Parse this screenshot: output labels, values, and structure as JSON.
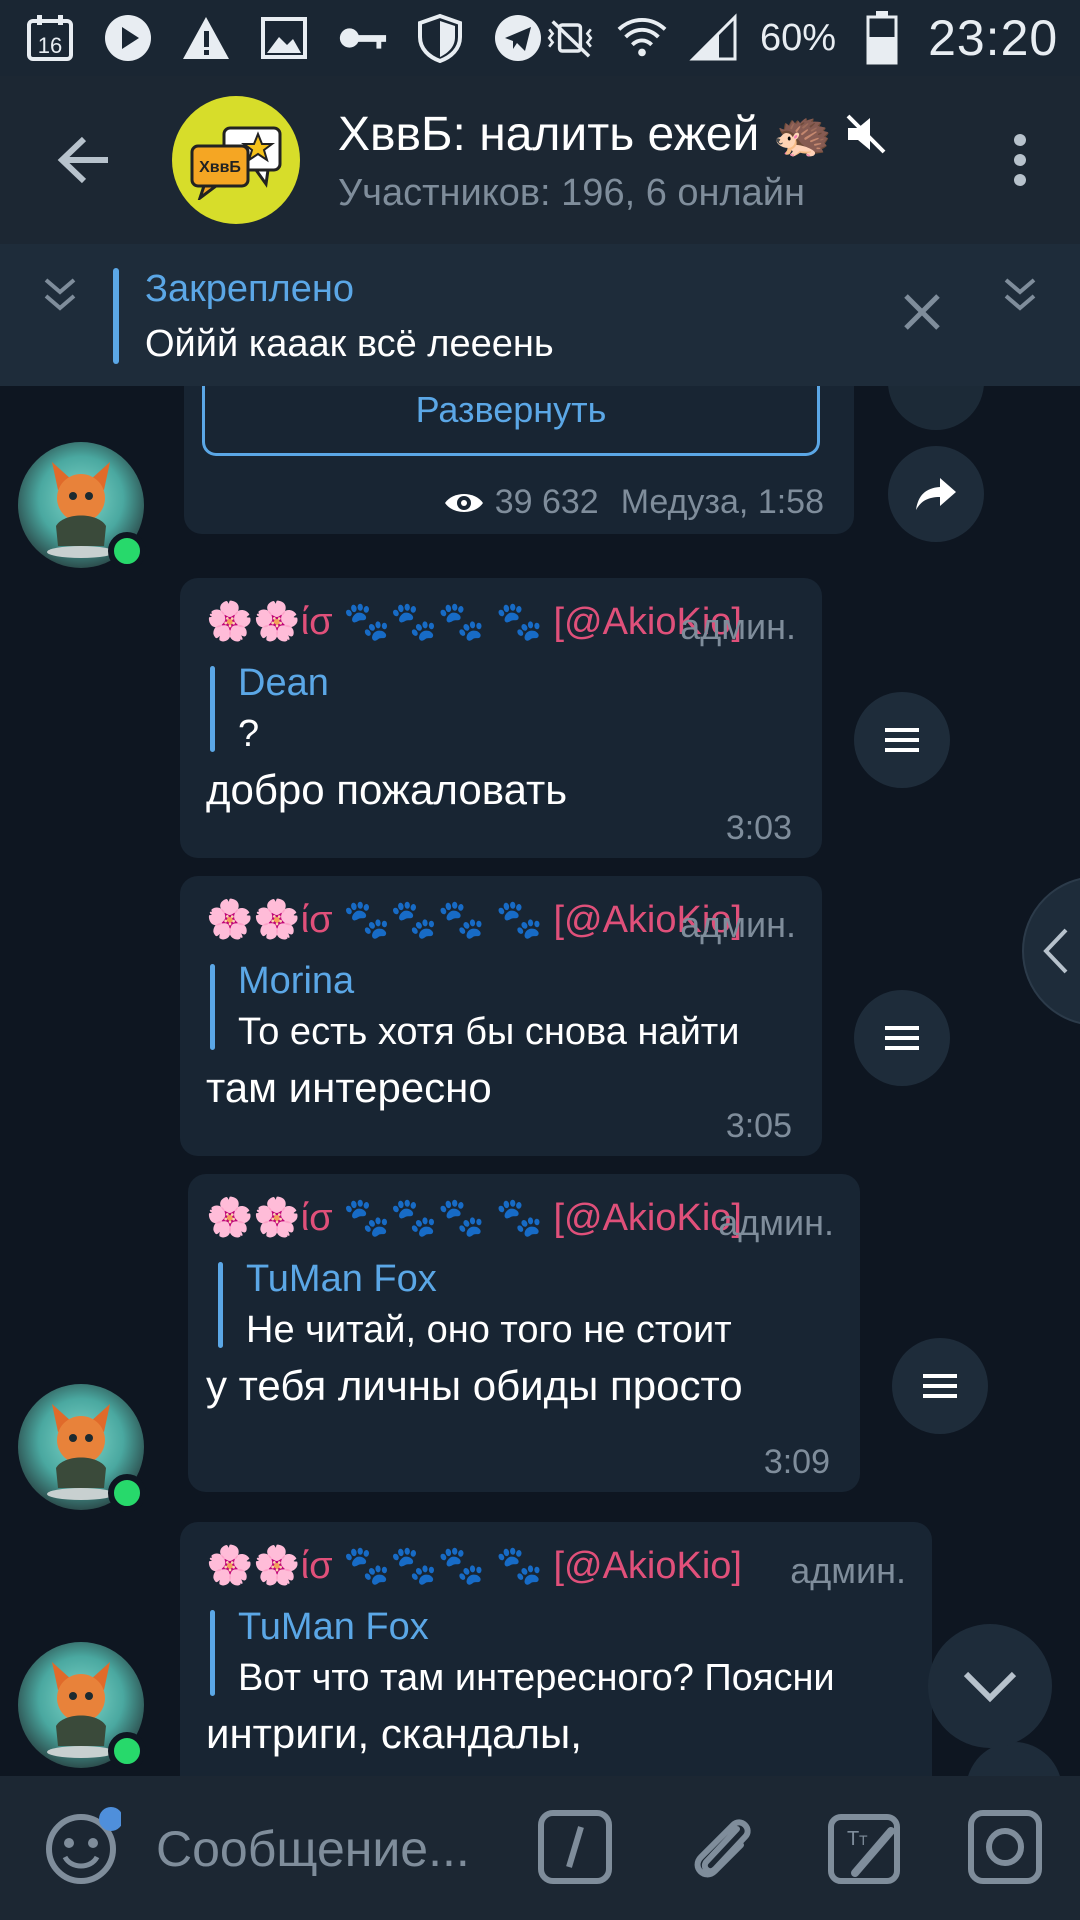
{
  "status_bar": {
    "date_icon_label": "16",
    "battery": "60%",
    "time": "23:20",
    "icons": [
      "calendar-icon",
      "play-icon",
      "warning-icon",
      "image-icon",
      "key-icon",
      "shield-icon",
      "telegram-icon",
      "mute-vibrate-icon",
      "wifi-icon",
      "signal-icon",
      "battery-icon"
    ]
  },
  "header": {
    "title": "ХввБ: налить ежей 🦔",
    "subtitle": "Участников: 196, 6 онлайн",
    "avatar_label": "ХввБ"
  },
  "pinned": {
    "label": "Закреплено",
    "text": "Оййй кааак всё лееень"
  },
  "channel_post": {
    "expand_label": "Развернуть",
    "views": "39 632",
    "signature": "Медуза, 1:58"
  },
  "messages": [
    {
      "sender": "🌸🌸ίσ 🐾🐾🐾 🐾 [@AkioKio]",
      "role": "админ.",
      "reply_name": "Dean",
      "reply_text": "?",
      "text": "добро пожаловать",
      "time": "3:03"
    },
    {
      "sender": "🌸🌸ίσ 🐾🐾🐾 🐾 [@AkioKio]",
      "role": "админ.",
      "reply_name": "Morina",
      "reply_text": "То есть хотя бы снова найти",
      "text": "там интересно",
      "time": "3:05"
    },
    {
      "sender": "🌸🌸ίσ 🐾🐾🐾 🐾 [@AkioKio]",
      "role": "админ.",
      "reply_name": "TuMan Fox",
      "reply_text": "Не читай, оно того не стоит",
      "text": "у тебя личны обиды просто",
      "time": "3:09"
    },
    {
      "sender": "🌸🌸ίσ 🐾🐾🐾 🐾 [@AkioKio]",
      "role": "админ.",
      "reply_name": "TuMan Fox",
      "reply_text": "Вот что там интересного? Поясни",
      "text": "интриги, скандалы,",
      "time": ""
    }
  ],
  "input": {
    "placeholder": "Сообщение..."
  },
  "colors": {
    "background": "#0e1621",
    "bubble": "#182533",
    "accent": "#5ba7e6",
    "sender": "#e0507a",
    "online": "#27d96b",
    "muted": "#7f8d9b"
  }
}
